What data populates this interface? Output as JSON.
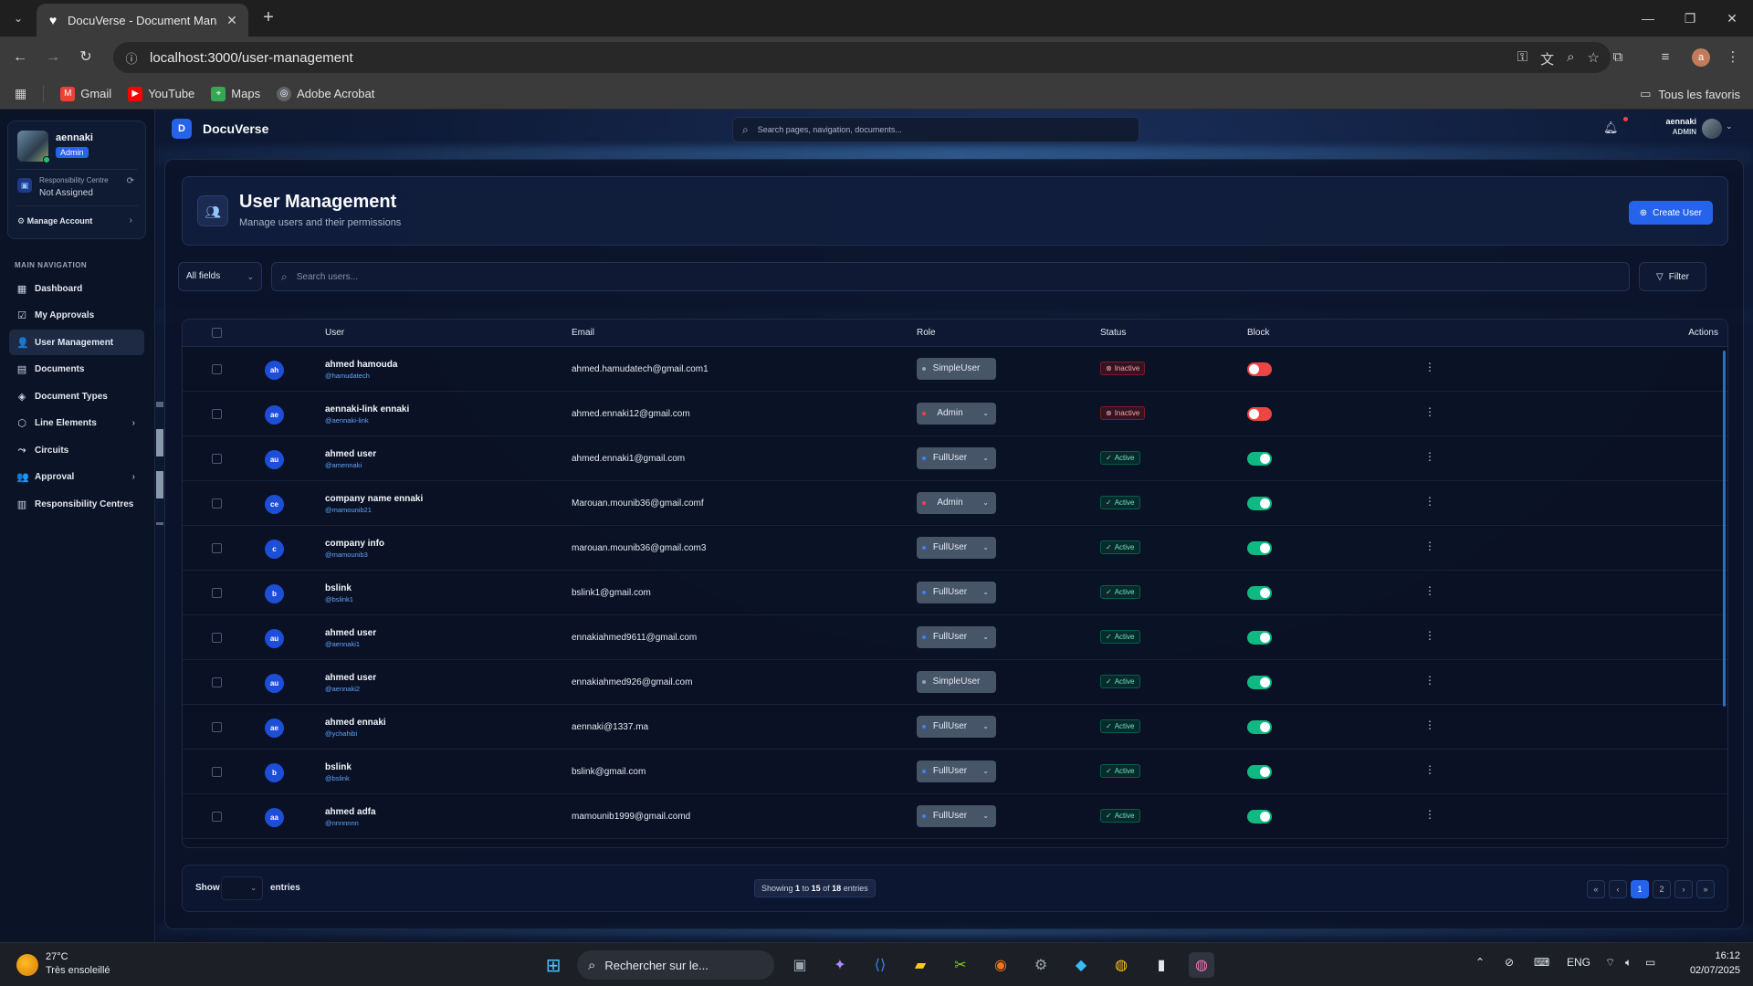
{
  "browser": {
    "tab_title": "DocuVerse - Document Manag",
    "url": "localhost:3000/user-management",
    "bookmarks": [
      {
        "label": "Gmail",
        "icon": "gmail-icon",
        "color": "#ea4335"
      },
      {
        "label": "YouTube",
        "icon": "youtube-icon",
        "color": "#ff0000"
      },
      {
        "label": "Maps",
        "icon": "maps-icon",
        "color": "#34a853"
      },
      {
        "label": "Adobe Acrobat",
        "icon": "acrobat-icon",
        "color": "#9aa0a6"
      }
    ],
    "all_bookmarks": "Tous les favoris",
    "profile_initial": "a"
  },
  "app": {
    "logo_letter": "D",
    "name": "DocuVerse",
    "search_placeholder": "Search pages, navigation, documents...",
    "header_user": {
      "name": "aennaki",
      "role": "ADMIN"
    }
  },
  "sidebar": {
    "user": {
      "name": "aennaki",
      "role": "Admin"
    },
    "responsibility": {
      "title": "Responsibility Centre",
      "value": "Not Assigned"
    },
    "manage_account": "Manage Account",
    "heading": "MAIN NAVIGATION",
    "items": [
      {
        "label": "Dashboard",
        "icon": "dashboard-icon",
        "glyph": "▦",
        "has_children": false,
        "active": false
      },
      {
        "label": "My Approvals",
        "icon": "approvals-icon",
        "glyph": "☑",
        "has_children": false,
        "active": false
      },
      {
        "label": "User Management",
        "icon": "users-icon",
        "glyph": "👤",
        "has_children": false,
        "active": true
      },
      {
        "label": "Documents",
        "icon": "document-icon",
        "glyph": "▤",
        "has_children": false,
        "active": false
      },
      {
        "label": "Document Types",
        "icon": "layers-icon",
        "glyph": "◈",
        "has_children": false,
        "active": false
      },
      {
        "label": "Line Elements",
        "icon": "cube-icon",
        "glyph": "⬡",
        "has_children": true,
        "active": false
      },
      {
        "label": "Circuits",
        "icon": "circuit-icon",
        "glyph": "⤳",
        "has_children": false,
        "active": false
      },
      {
        "label": "Approval",
        "icon": "approval-user-icon",
        "glyph": "👥",
        "has_children": true,
        "active": false
      },
      {
        "label": "Responsibility Centres",
        "icon": "building-icon",
        "glyph": "▥",
        "has_children": false,
        "active": false
      }
    ]
  },
  "page": {
    "title": "User Management",
    "subtitle": "Manage users and their permissions",
    "create_button": "Create User",
    "field_select": "All fields",
    "search_placeholder": "Search users...",
    "filter_button": "Filter"
  },
  "table": {
    "columns": [
      "User",
      "Email",
      "Role",
      "Status",
      "Block",
      "Actions"
    ],
    "rows": [
      {
        "initials": "ah",
        "name": "ahmed hamouda",
        "handle": "@hamudatech",
        "email": "ahmed.hamudatech@gmail.com1",
        "role": "SimpleUser",
        "status": "Inactive",
        "blocked": true
      },
      {
        "initials": "ae",
        "name": "aennaki-link ennaki",
        "handle": "@aennaki-link",
        "email": "ahmed.ennaki12@gmail.com",
        "role": "Admin",
        "status": "Inactive",
        "blocked": true
      },
      {
        "initials": "au",
        "name": "ahmed user",
        "handle": "@amennaki",
        "email": "ahmed.ennaki1@gmail.com",
        "role": "FullUser",
        "status": "Active",
        "blocked": false
      },
      {
        "initials": "ce",
        "name": "company name ennaki",
        "handle": "@mamounib21",
        "email": "Marouan.mounib36@gmail.comf",
        "role": "Admin",
        "status": "Active",
        "blocked": false
      },
      {
        "initials": "c",
        "name": "company info",
        "handle": "@mamounib3",
        "email": "marouan.mounib36@gmail.com3",
        "role": "FullUser",
        "status": "Active",
        "blocked": false
      },
      {
        "initials": "b",
        "name": "bslink",
        "handle": "@bslink1",
        "email": "bslink1@gmail.com",
        "role": "FullUser",
        "status": "Active",
        "blocked": false
      },
      {
        "initials": "au",
        "name": "ahmed user",
        "handle": "@aennaki1",
        "email": "ennakiahmed9611@gmail.com",
        "role": "FullUser",
        "status": "Active",
        "blocked": false
      },
      {
        "initials": "au",
        "name": "ahmed user",
        "handle": "@aennaki2",
        "email": "ennakiahmed926@gmail.com",
        "role": "SimpleUser",
        "status": "Active",
        "blocked": false
      },
      {
        "initials": "ae",
        "name": "ahmed ennaki",
        "handle": "@ychahibi",
        "email": "aennaki@1337.ma",
        "role": "FullUser",
        "status": "Active",
        "blocked": false
      },
      {
        "initials": "b",
        "name": "bslink",
        "handle": "@bslink",
        "email": "bslink@gmail.com",
        "role": "FullUser",
        "status": "Active",
        "blocked": false
      },
      {
        "initials": "aa",
        "name": "ahmed adfa",
        "handle": "@nnnnnnn",
        "email": "mamounib1999@gmail.comd",
        "role": "FullUser",
        "status": "Active",
        "blocked": false
      }
    ]
  },
  "footer": {
    "show": "Show",
    "entries": "entries",
    "showing_prefix": "Showing",
    "from": "1",
    "to_word": "to",
    "to": "15",
    "of_word": "of",
    "total": "18",
    "suffix": "entries",
    "pages": [
      "1",
      "2"
    ],
    "current_page": "1"
  },
  "taskbar": {
    "temp": "27°C",
    "weather": "Très ensoleillé",
    "search": "Rechercher sur le...",
    "lang": "ENG",
    "time": "16:12",
    "date": "02/07/2025"
  },
  "colors": {
    "accent": "#2563eb",
    "active_status": "#10b981",
    "inactive_status": "#ef4444",
    "admin_dot": "#ef4444",
    "fulluser_dot": "#3b82f6",
    "simpleuser_dot": "#94a3b8"
  }
}
